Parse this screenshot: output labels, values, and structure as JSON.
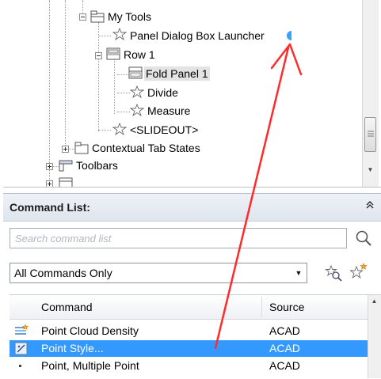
{
  "tree": {
    "items": [
      {
        "label": "My Tools"
      },
      {
        "label": "Panel Dialog Box Launcher"
      },
      {
        "label": "Row 1"
      },
      {
        "label": "Fold Panel 1"
      },
      {
        "label": "Divide"
      },
      {
        "label": "Measure"
      },
      {
        "label": "<SLIDEOUT>"
      },
      {
        "label": "Contextual Tab States"
      },
      {
        "label": "Toolbars"
      }
    ]
  },
  "command_list": {
    "title": "Command List:",
    "search_placeholder": "Search command list",
    "filter": {
      "selected": "All Commands Only"
    },
    "columns": {
      "command": "Command",
      "source": "Source"
    },
    "rows": [
      {
        "command": "Point Cloud Density",
        "source": "ACAD",
        "icon": "point-cloud-density-icon"
      },
      {
        "command": "Point Style...",
        "source": "ACAD",
        "icon": "point-style-icon",
        "selected": true
      },
      {
        "command": "Point, Multiple Point",
        "source": "ACAD",
        "icon": "point-icon"
      }
    ]
  },
  "colors": {
    "selection": "#3399ff",
    "annotation_arrow": "#ff2a2a",
    "marker_dot": "#3aa0ff"
  }
}
